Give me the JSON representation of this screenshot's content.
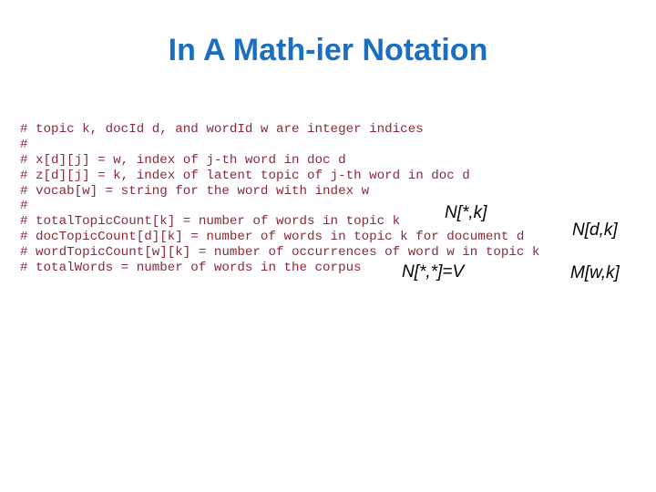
{
  "slide": {
    "title": "In A Math-ier Notation",
    "code_lines": [
      "# topic k, docId d, and wordId w are integer indices",
      "#",
      "# x[d][j] = w, index of j-th word in doc d",
      "# z[d][j] = k, index of latent topic of j-th word in doc d",
      "# vocab[w] = string for the word with index w",
      "#",
      "# totalTopicCount[k] = number of words in topic k",
      "# docTopicCount[d][k] = number of words in topic k for document d",
      "# wordTopicCount[w][k] = number of occurrences of word w in topic k",
      "# totalWords = number of words in the corpus"
    ],
    "annotations": {
      "total_topic_count": "N[*,k]",
      "doc_topic_count": "N[d,k]",
      "total_words": "N[*,*]=V",
      "word_topic_count": "M[w,k]"
    }
  }
}
